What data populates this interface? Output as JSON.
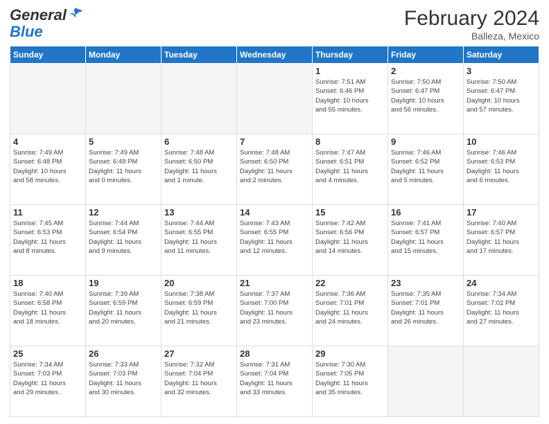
{
  "header": {
    "logo_general": "General",
    "logo_blue": "Blue",
    "month_title": "February 2024",
    "location": "Balleza, Mexico"
  },
  "weekdays": [
    "Sunday",
    "Monday",
    "Tuesday",
    "Wednesday",
    "Thursday",
    "Friday",
    "Saturday"
  ],
  "weeks": [
    [
      {
        "day": "",
        "info": "",
        "empty": true
      },
      {
        "day": "",
        "info": "",
        "empty": true
      },
      {
        "day": "",
        "info": "",
        "empty": true
      },
      {
        "day": "",
        "info": "",
        "empty": true
      },
      {
        "day": "1",
        "info": "Sunrise: 7:51 AM\nSunset: 6:46 PM\nDaylight: 10 hours\nand 55 minutes.",
        "empty": false
      },
      {
        "day": "2",
        "info": "Sunrise: 7:50 AM\nSunset: 6:47 PM\nDaylight: 10 hours\nand 56 minutes.",
        "empty": false
      },
      {
        "day": "3",
        "info": "Sunrise: 7:50 AM\nSunset: 6:47 PM\nDaylight: 10 hours\nand 57 minutes.",
        "empty": false
      }
    ],
    [
      {
        "day": "4",
        "info": "Sunrise: 7:49 AM\nSunset: 6:48 PM\nDaylight: 10 hours\nand 58 minutes.",
        "empty": false
      },
      {
        "day": "5",
        "info": "Sunrise: 7:49 AM\nSunset: 6:49 PM\nDaylight: 11 hours\nand 0 minutes.",
        "empty": false
      },
      {
        "day": "6",
        "info": "Sunrise: 7:48 AM\nSunset: 6:50 PM\nDaylight: 11 hours\nand 1 minute.",
        "empty": false
      },
      {
        "day": "7",
        "info": "Sunrise: 7:48 AM\nSunset: 6:50 PM\nDaylight: 11 hours\nand 2 minutes.",
        "empty": false
      },
      {
        "day": "8",
        "info": "Sunrise: 7:47 AM\nSunset: 6:51 PM\nDaylight: 11 hours\nand 4 minutes.",
        "empty": false
      },
      {
        "day": "9",
        "info": "Sunrise: 7:46 AM\nSunset: 6:52 PM\nDaylight: 11 hours\nand 5 minutes.",
        "empty": false
      },
      {
        "day": "10",
        "info": "Sunrise: 7:46 AM\nSunset: 6:53 PM\nDaylight: 11 hours\nand 6 minutes.",
        "empty": false
      }
    ],
    [
      {
        "day": "11",
        "info": "Sunrise: 7:45 AM\nSunset: 6:53 PM\nDaylight: 11 hours\nand 8 minutes.",
        "empty": false
      },
      {
        "day": "12",
        "info": "Sunrise: 7:44 AM\nSunset: 6:54 PM\nDaylight: 11 hours\nand 9 minutes.",
        "empty": false
      },
      {
        "day": "13",
        "info": "Sunrise: 7:44 AM\nSunset: 6:55 PM\nDaylight: 11 hours\nand 11 minutes.",
        "empty": false
      },
      {
        "day": "14",
        "info": "Sunrise: 7:43 AM\nSunset: 6:55 PM\nDaylight: 11 hours\nand 12 minutes.",
        "empty": false
      },
      {
        "day": "15",
        "info": "Sunrise: 7:42 AM\nSunset: 6:56 PM\nDaylight: 11 hours\nand 14 minutes.",
        "empty": false
      },
      {
        "day": "16",
        "info": "Sunrise: 7:41 AM\nSunset: 6:57 PM\nDaylight: 11 hours\nand 15 minutes.",
        "empty": false
      },
      {
        "day": "17",
        "info": "Sunrise: 7:40 AM\nSunset: 6:57 PM\nDaylight: 11 hours\nand 17 minutes.",
        "empty": false
      }
    ],
    [
      {
        "day": "18",
        "info": "Sunrise: 7:40 AM\nSunset: 6:58 PM\nDaylight: 11 hours\nand 18 minutes.",
        "empty": false
      },
      {
        "day": "19",
        "info": "Sunrise: 7:39 AM\nSunset: 6:59 PM\nDaylight: 11 hours\nand 20 minutes.",
        "empty": false
      },
      {
        "day": "20",
        "info": "Sunrise: 7:38 AM\nSunset: 6:59 PM\nDaylight: 11 hours\nand 21 minutes.",
        "empty": false
      },
      {
        "day": "21",
        "info": "Sunrise: 7:37 AM\nSunset: 7:00 PM\nDaylight: 11 hours\nand 23 minutes.",
        "empty": false
      },
      {
        "day": "22",
        "info": "Sunrise: 7:36 AM\nSunset: 7:01 PM\nDaylight: 11 hours\nand 24 minutes.",
        "empty": false
      },
      {
        "day": "23",
        "info": "Sunrise: 7:35 AM\nSunset: 7:01 PM\nDaylight: 11 hours\nand 26 minutes.",
        "empty": false
      },
      {
        "day": "24",
        "info": "Sunrise: 7:34 AM\nSunset: 7:02 PM\nDaylight: 11 hours\nand 27 minutes.",
        "empty": false
      }
    ],
    [
      {
        "day": "25",
        "info": "Sunrise: 7:34 AM\nSunset: 7:03 PM\nDaylight: 11 hours\nand 29 minutes.",
        "empty": false
      },
      {
        "day": "26",
        "info": "Sunrise: 7:33 AM\nSunset: 7:03 PM\nDaylight: 11 hours\nand 30 minutes.",
        "empty": false
      },
      {
        "day": "27",
        "info": "Sunrise: 7:32 AM\nSunset: 7:04 PM\nDaylight: 11 hours\nand 32 minutes.",
        "empty": false
      },
      {
        "day": "28",
        "info": "Sunrise: 7:31 AM\nSunset: 7:04 PM\nDaylight: 11 hours\nand 33 minutes.",
        "empty": false
      },
      {
        "day": "29",
        "info": "Sunrise: 7:30 AM\nSunset: 7:05 PM\nDaylight: 11 hours\nand 35 minutes.",
        "empty": false
      },
      {
        "day": "",
        "info": "",
        "empty": true
      },
      {
        "day": "",
        "info": "",
        "empty": true
      }
    ]
  ]
}
